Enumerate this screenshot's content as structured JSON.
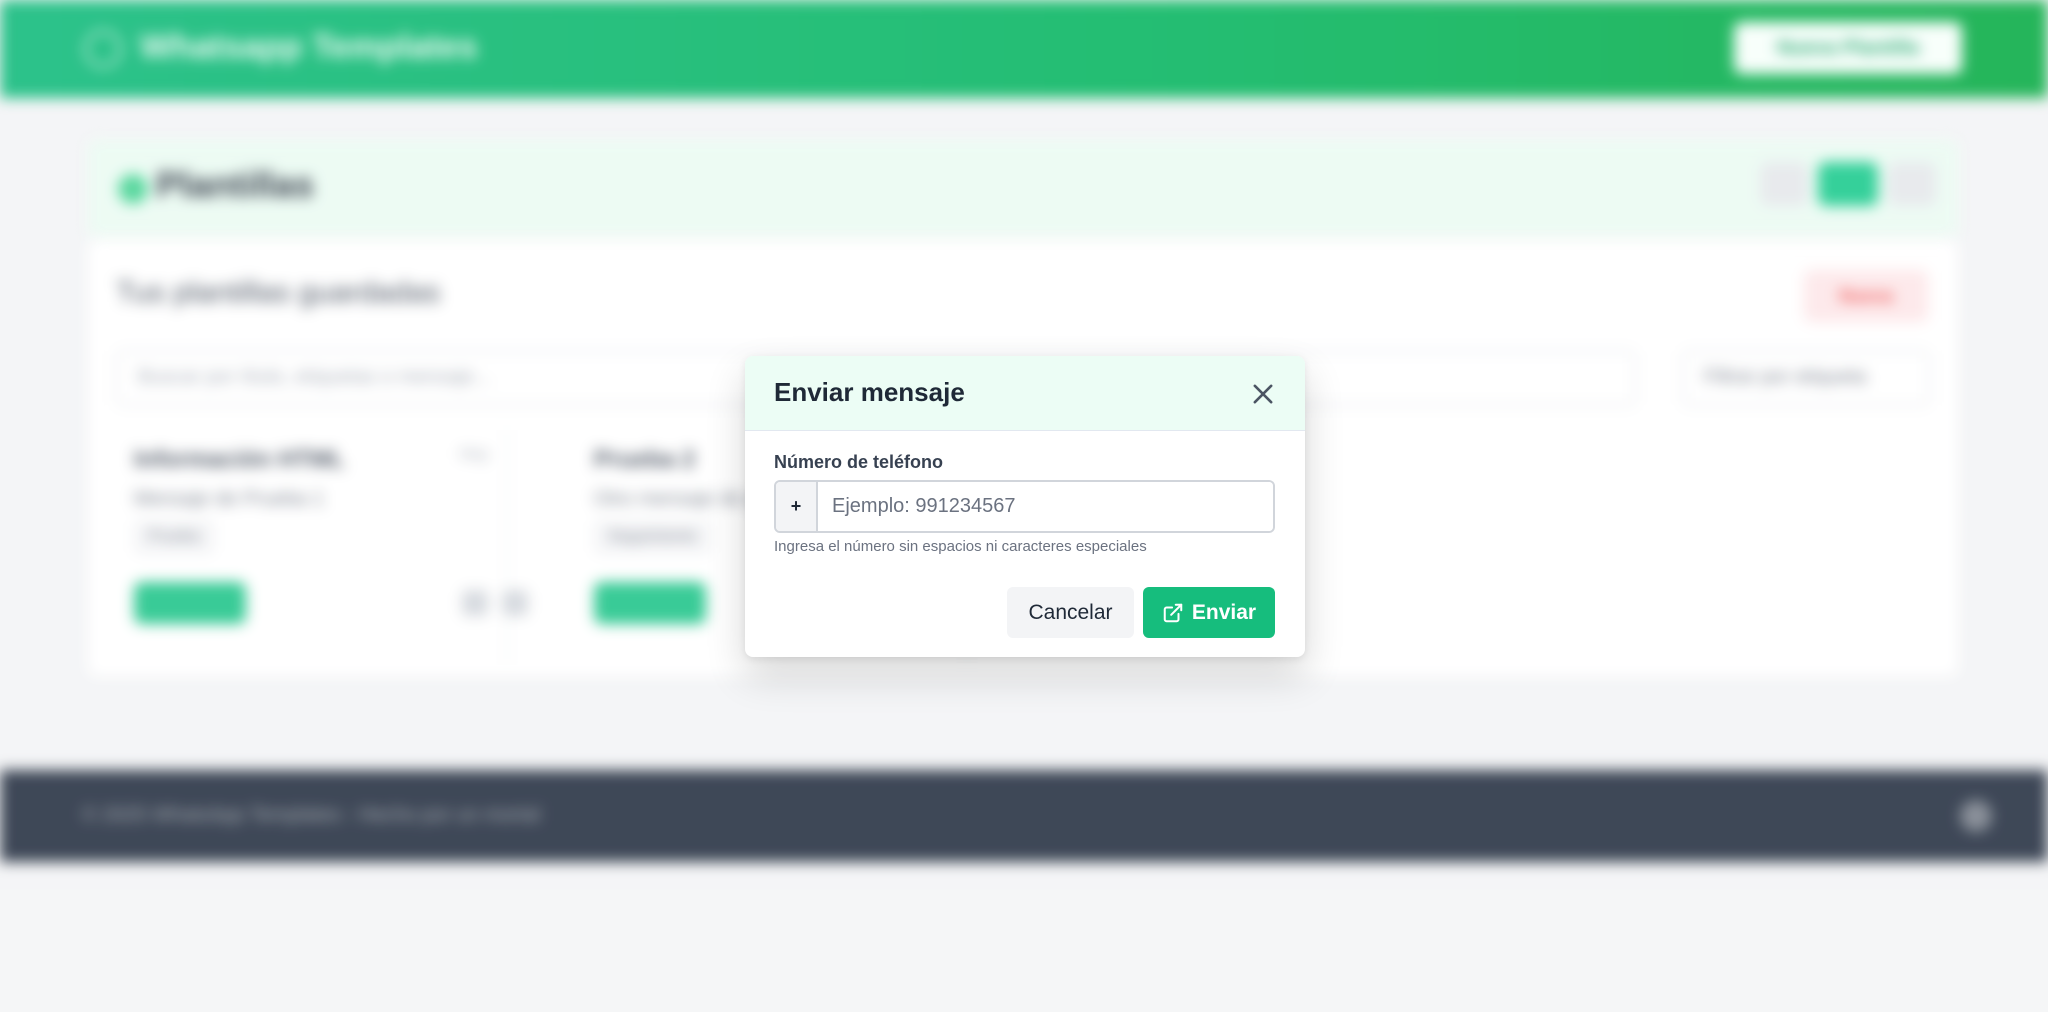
{
  "background": {
    "header": {
      "app_title": "Whatsapp Templates",
      "action_label": "Nueva Plantilla"
    },
    "page": {
      "title": "Plantillas"
    },
    "panel": {
      "title": "Tus plantillas guardadas",
      "new_button": "Nueva",
      "search_placeholder": "Buscar por título, etiquetas o mensaje...",
      "filter_label": "Filtrar por etiqueta",
      "cards": [
        {
          "name": "Información HTML",
          "meta": "Mensaje de Prueba 1",
          "tag": "Prueba",
          "date": "Hoy"
        },
        {
          "name": "Prueba 2",
          "meta": "Otro mensaje de prueba",
          "tag": "Seguimiento",
          "date": ""
        }
      ]
    },
    "footer": {
      "copyright": "© 2025 WhatsApp Templates - Hecho por un mortal"
    }
  },
  "modal": {
    "title": "Enviar mensaje",
    "close_icon": "close-icon",
    "phone": {
      "label": "Número de teléfono",
      "prefix": "+",
      "placeholder": "Ejemplo: 991234567",
      "value": "",
      "hint": "Ingresa el número sin espacios ni caracteres especiales"
    },
    "buttons": {
      "cancel": "Cancelar",
      "send": "Enviar",
      "send_icon": "external-link-icon"
    }
  },
  "colors": {
    "brand_green": "#16bd7d",
    "header_bg": "#ecfdf5",
    "footer_bg": "#1f2a3c"
  }
}
